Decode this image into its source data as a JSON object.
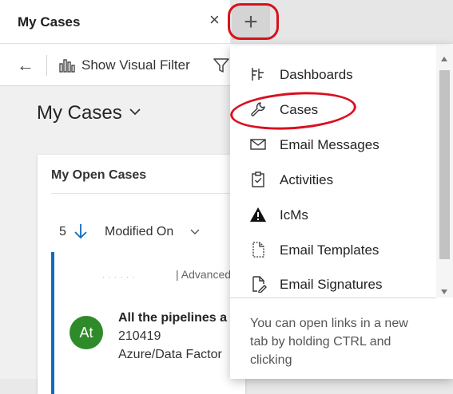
{
  "tab": {
    "title": "My Cases",
    "close": "×",
    "new_tab": "+"
  },
  "commandbar": {
    "back": "←",
    "show_visual_filter": "Show Visual Filter"
  },
  "view": {
    "title": "My Cases"
  },
  "card": {
    "title": "My Open Cases",
    "sort_count": "5",
    "sort_field": "Modified On",
    "row_fragment": "| Advanced",
    "row_dots": "· · · · · ·",
    "row": {
      "avatar_initials": "At",
      "title": "All the pipelines a",
      "number": "210419",
      "subtitle": "Azure/Data Factor"
    }
  },
  "menu": {
    "items": [
      {
        "label": "Dashboards",
        "icon": "dashboards-icon"
      },
      {
        "label": "Cases",
        "icon": "wrench-icon"
      },
      {
        "label": "Email Messages",
        "icon": "envelope-icon"
      },
      {
        "label": "Activities",
        "icon": "clipboard-icon"
      },
      {
        "label": "IcMs",
        "icon": "warning-triangle-icon"
      },
      {
        "label": "Email Templates",
        "icon": "document-icon"
      },
      {
        "label": "Email Signatures",
        "icon": "signature-document-icon"
      }
    ],
    "hint": "You can open links in a new tab by holding CTRL and clicking"
  },
  "colors": {
    "annotation_red": "#d9101f",
    "accent_blue": "#0f6cbd",
    "avatar_green": "#2f8a2a"
  }
}
